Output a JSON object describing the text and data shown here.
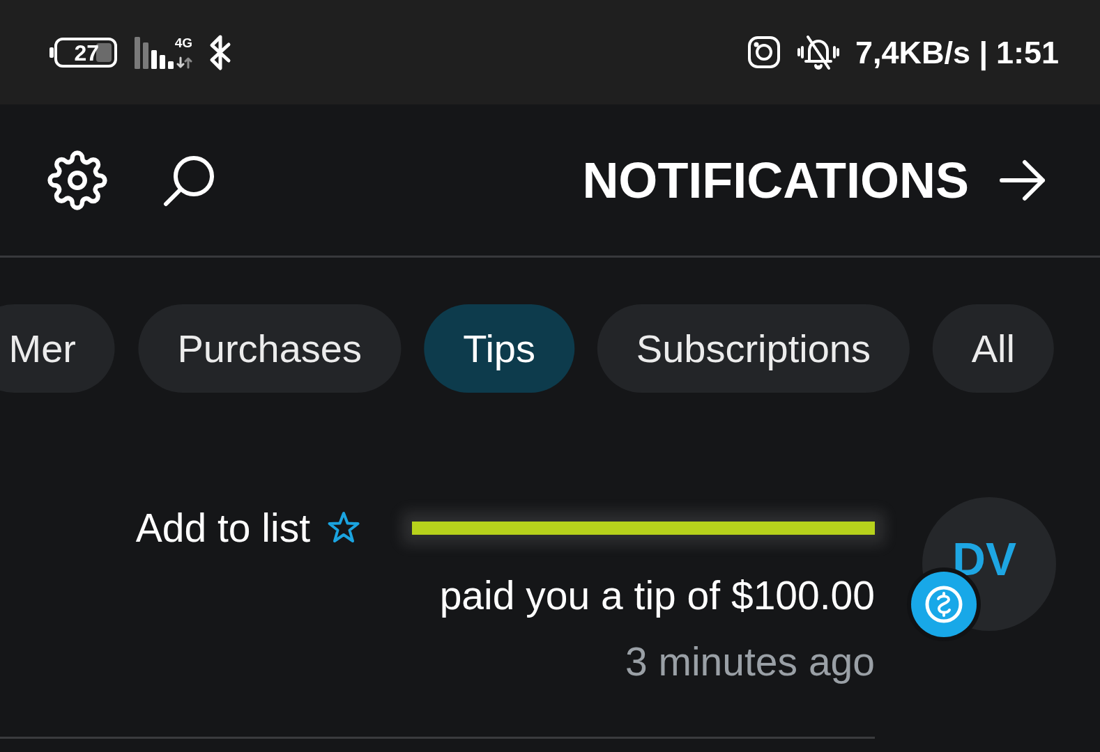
{
  "status_bar": {
    "battery": "27",
    "network": "4G",
    "net_speed": "7,4KB/s",
    "separator": "|",
    "time": "1:51"
  },
  "header": {
    "title": "NOTIFICATIONS"
  },
  "tabs": [
    {
      "label": "Mer",
      "selected": false
    },
    {
      "label": "Purchases",
      "selected": false
    },
    {
      "label": "Tips",
      "selected": true
    },
    {
      "label": "Subscriptions",
      "selected": false
    },
    {
      "label": "All",
      "selected": false
    }
  ],
  "notifications": [
    {
      "avatar_initials": "DV",
      "action": "Add to list",
      "message": "paid you a tip of $100.00",
      "time": "3 minutes ago"
    }
  ]
}
